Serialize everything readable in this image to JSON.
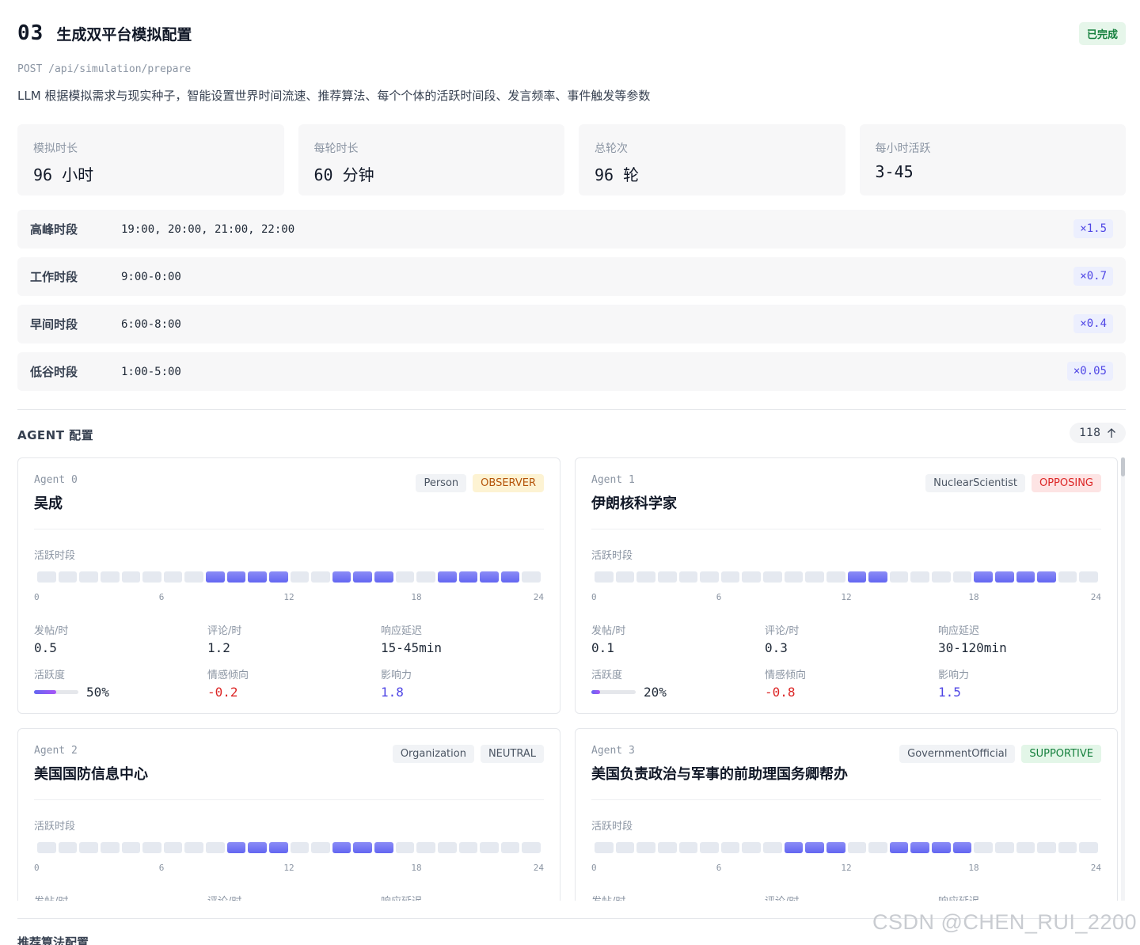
{
  "header": {
    "step_number": "03",
    "title": "生成双平台模拟配置",
    "status": "已完成",
    "endpoint": "POST /api/simulation/prepare",
    "description": "LLM 根据模拟需求与现实种子，智能设置世界时间流速、推荐算法、每个个体的活跃时间段、发言频率、事件触发等参数"
  },
  "stats": [
    {
      "label": "模拟时长",
      "value": "96 小时"
    },
    {
      "label": "每轮时长",
      "value": "60 分钟"
    },
    {
      "label": "总轮次",
      "value": "96 轮"
    },
    {
      "label": "每小时活跃",
      "value": "3-45"
    }
  ],
  "periods": [
    {
      "name": "高峰时段",
      "hours": "19:00, 20:00, 21:00, 22:00",
      "multiplier": "×1.5"
    },
    {
      "name": "工作时段",
      "hours": "9:00-0:00",
      "multiplier": "×0.7"
    },
    {
      "name": "早间时段",
      "hours": "6:00-8:00",
      "multiplier": "×0.4"
    },
    {
      "name": "低谷时段",
      "hours": "1:00-5:00",
      "multiplier": "×0.05"
    }
  ],
  "agents_section": {
    "title": "AGENT 配置",
    "count": "118",
    "hours_label": "活跃时段",
    "axis_ticks": [
      "0",
      "6",
      "12",
      "18",
      "24"
    ],
    "labels": {
      "posts": "发帖/时",
      "comments": "评论/时",
      "latency": "响应延迟",
      "activity": "活跃度",
      "sentiment": "情感倾向",
      "influence": "影响力"
    }
  },
  "agents": [
    {
      "id": "Agent 0",
      "name": "吴成",
      "type": "Person",
      "stance": "OBSERVER",
      "stance_bg": "#fdf3d3",
      "stance_color": "#b45309",
      "active_hours": [
        8,
        9,
        10,
        11,
        14,
        15,
        16,
        19,
        20,
        21,
        22
      ],
      "posts": "0.5",
      "comments": "1.2",
      "latency": "15-45min",
      "activity": "50%",
      "activity_level": 0.5,
      "sentiment": "-0.2",
      "influence": "1.8"
    },
    {
      "id": "Agent 1",
      "name": "伊朗核科学家",
      "type": "NuclearScientist",
      "stance": "OPPOSING",
      "stance_bg": "#fde4e4",
      "stance_color": "#dc2626",
      "active_hours": [
        12,
        13,
        18,
        19,
        20,
        21
      ],
      "posts": "0.1",
      "comments": "0.3",
      "latency": "30-120min",
      "activity": "20%",
      "activity_level": 0.2,
      "sentiment": "-0.8",
      "influence": "1.5"
    },
    {
      "id": "Agent 2",
      "name": "美国国防信息中心",
      "type": "Organization",
      "stance": "NEUTRAL",
      "stance_bg": "#f1f3f6",
      "stance_color": "#4b5563",
      "active_hours": [
        9,
        10,
        11,
        14,
        15,
        16
      ],
      "posts": "",
      "comments": "",
      "latency": "",
      "activity": "",
      "activity_level": 0,
      "sentiment": "",
      "influence": ""
    },
    {
      "id": "Agent 3",
      "name": "美国负责政治与军事的前助理国务卿帮办",
      "type": "GovernmentOfficial",
      "stance": "SUPPORTIVE",
      "stance_bg": "#e3f6e8",
      "stance_color": "#15803d",
      "active_hours": [
        9,
        10,
        11,
        14,
        15,
        16,
        17
      ],
      "posts": "",
      "comments": "",
      "latency": "",
      "activity": "",
      "activity_level": 0,
      "sentiment": "",
      "influence": ""
    }
  ],
  "next_section": "推荐算法配置",
  "watermark": "CSDN @CHEN_RUI_2200"
}
